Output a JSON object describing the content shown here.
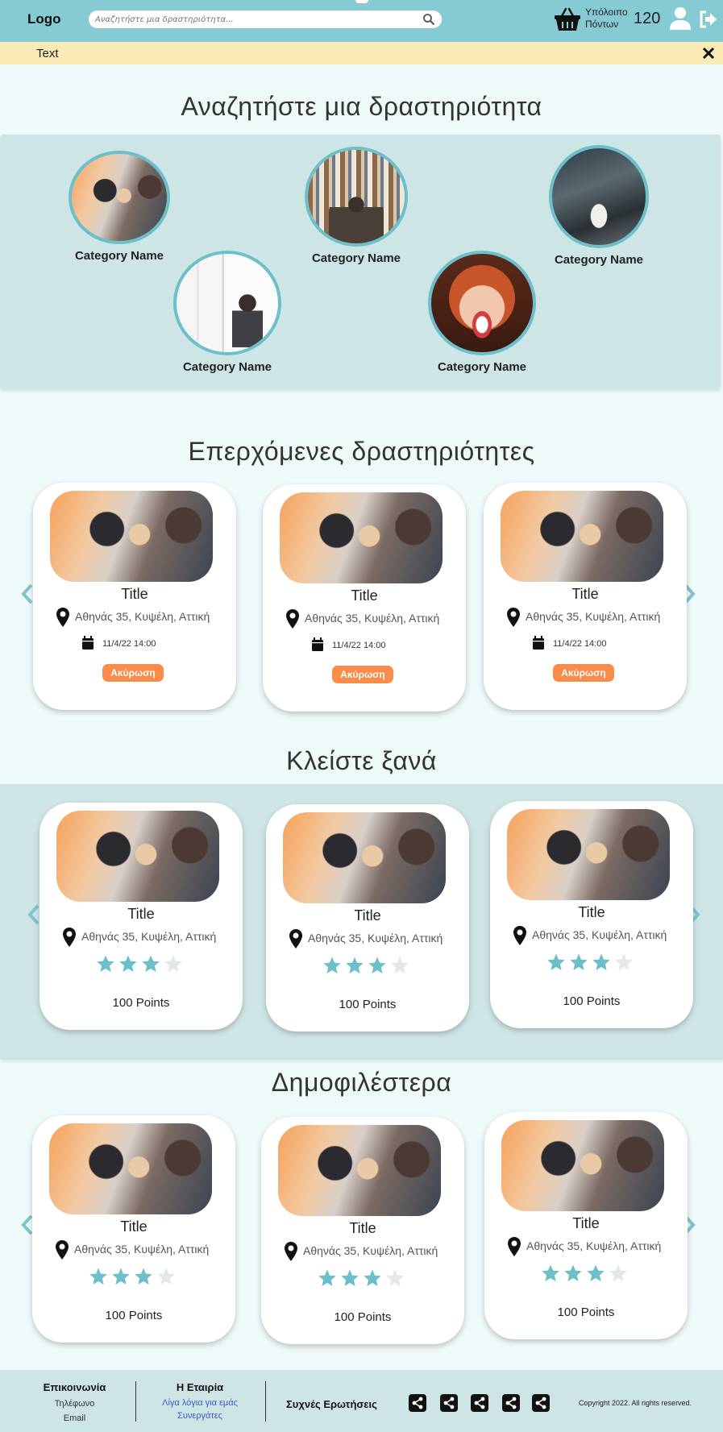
{
  "header": {
    "logo": "Logo",
    "search_placeholder": "Αναζητήστε μια δραστηριότητα...",
    "balance_label": "Υπόλοιπο Πόντων",
    "balance_value": "120",
    "icons": [
      "search-icon",
      "basket-icon",
      "user-icon",
      "logout-icon"
    ]
  },
  "notice": {
    "text": "Text"
  },
  "categories": {
    "heading": "Αναζητήστε μια δραστηριότητα",
    "items": [
      {
        "name": "Category Name"
      },
      {
        "name": "Category Name"
      },
      {
        "name": "Category Name"
      },
      {
        "name": "Category Name"
      },
      {
        "name": "Category Name"
      }
    ]
  },
  "upcoming": {
    "heading": "Επερχόμενες δραστηριότητες",
    "cards": [
      {
        "title": "Title",
        "location": "Αθηνάς 35, Κυψέλη, Αττική",
        "date": "11/4/22 14:00",
        "button": "Ακύρωση"
      },
      {
        "title": "Title",
        "location": "Αθηνάς 35, Κυψέλη, Αττική",
        "date": "11/4/22 14:00",
        "button": "Ακύρωση"
      },
      {
        "title": "Title",
        "location": "Αθηνάς 35, Κυψέλη, Αττική",
        "date": "11/4/22 14:00",
        "button": "Ακύρωση"
      }
    ]
  },
  "rebook": {
    "heading": "Κλείστε ξανά",
    "cards": [
      {
        "title": "Title",
        "location": "Αθηνάς 35, Κυψέλη, Αττική",
        "rating": 3,
        "max_rating": 4,
        "points": "100 Points"
      },
      {
        "title": "Title",
        "location": "Αθηνάς 35, Κυψέλη, Αττική",
        "rating": 3,
        "max_rating": 4,
        "points": "100 Points"
      },
      {
        "title": "Title",
        "location": "Αθηνάς 35, Κυψέλη, Αττική",
        "rating": 3,
        "max_rating": 4,
        "points": "100 Points"
      }
    ]
  },
  "popular": {
    "heading": "Δημοφιλέστερα",
    "cards": [
      {
        "title": "Title",
        "location": "Αθηνάς 35, Κυψέλη, Αττική",
        "rating": 3,
        "max_rating": 4,
        "points": "100 Points"
      },
      {
        "title": "Title",
        "location": "Αθηνάς 35, Κυψέλη, Αττική",
        "rating": 3,
        "max_rating": 4,
        "points": "100 Points"
      },
      {
        "title": "Title",
        "location": "Αθηνάς 35, Κυψέλη, Αττική",
        "rating": 3,
        "max_rating": 4,
        "points": "100 Points"
      }
    ]
  },
  "footer": {
    "contact": {
      "heading": "Επικοινωνία",
      "phone": "Τηλέφωνο",
      "email": "Email"
    },
    "company": {
      "heading": "Η Εταιρία",
      "about": "Λίγα λόγια για εμάς",
      "partners": "Συνεργάτες"
    },
    "faq": "Συχνές Ερωτήσεις",
    "copyright": "Copyright 2022. All rights reserved."
  },
  "colors": {
    "header": "#86cad4",
    "notice": "#f9eab6",
    "page_bg": "#eefafa",
    "band": "#cee5e6",
    "accent": "#6dbfc9",
    "cancel_button": "#f98c4a",
    "star_filled": "#6dbfc9",
    "star_empty": "#e2e8ea"
  }
}
